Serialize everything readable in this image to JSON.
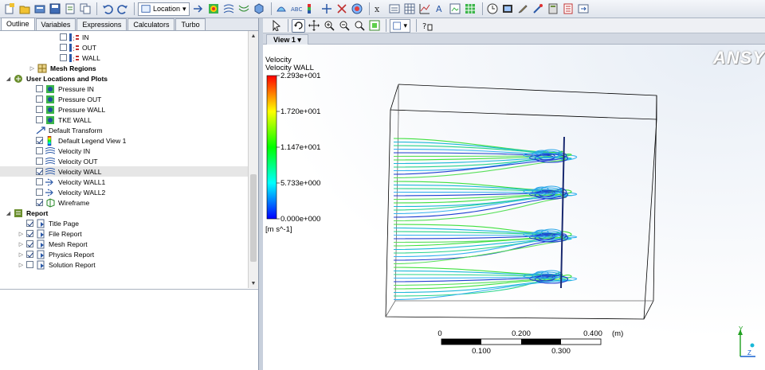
{
  "toolbar": {
    "location_label": "Location"
  },
  "left_panel": {
    "tabs": [
      "Outline",
      "Variables",
      "Expressions",
      "Calculators",
      "Turbo"
    ],
    "tree": [
      {
        "label": "IN",
        "checked": false,
        "bold": false
      },
      {
        "label": "OUT",
        "checked": false,
        "bold": false
      },
      {
        "label": "WALL",
        "checked": false,
        "bold": false
      },
      {
        "label": "Mesh Regions",
        "checked": false,
        "bold": true
      },
      {
        "label": "User Locations and Plots",
        "checked": false,
        "bold": true
      },
      {
        "label": "Pressure IN",
        "checked": false,
        "bold": false
      },
      {
        "label": "Pressure OUT",
        "checked": false,
        "bold": false
      },
      {
        "label": "Pressure WALL",
        "checked": false,
        "bold": false
      },
      {
        "label": "TKE WALL",
        "checked": false,
        "bold": false
      },
      {
        "label": "Default Transform",
        "checked": false,
        "bold": false
      },
      {
        "label": "Default Legend View 1",
        "checked": true,
        "bold": false
      },
      {
        "label": "Velocity IN",
        "checked": false,
        "bold": false
      },
      {
        "label": "Velocity OUT",
        "checked": false,
        "bold": false
      },
      {
        "label": "Velocity WALL",
        "checked": true,
        "bold": false,
        "selected": true
      },
      {
        "label": "Velocity WALL1",
        "checked": false,
        "bold": false
      },
      {
        "label": "Velocity WALL2",
        "checked": false,
        "bold": false
      },
      {
        "label": "Wireframe",
        "checked": true,
        "bold": false
      },
      {
        "label": "Report",
        "checked": false,
        "bold": true
      },
      {
        "label": "Title Page",
        "checked": true,
        "bold": false
      },
      {
        "label": "File Report",
        "checked": true,
        "bold": false
      },
      {
        "label": "Mesh Report",
        "checked": true,
        "bold": false
      },
      {
        "label": "Physics Report",
        "checked": true,
        "bold": false
      },
      {
        "label": "Solution Report",
        "checked": false,
        "bold": false
      }
    ]
  },
  "viewer": {
    "view_tab": "View 1",
    "logo": "ANSY"
  },
  "legend": {
    "title": "Velocity",
    "subtitle": "Velocity WALL",
    "ticks": [
      "2.293e+001",
      "1.720e+001",
      "1.147e+001",
      "5.733e+000",
      "0.000e+000"
    ],
    "unit": "[m s^-1]"
  },
  "scale_bar": {
    "top_labels": [
      "0",
      "0.200",
      "0.400"
    ],
    "unit": "(m)",
    "bottom_labels": [
      "0.100",
      "0.300"
    ]
  },
  "axes": {
    "y": "Y",
    "z": "Z"
  },
  "colors": {
    "accent": "#1f4fa0",
    "streamline_green": "#3fe03f",
    "streamline_cyan": "#1bb8d8",
    "streamline_blue": "#1f3fd0"
  }
}
